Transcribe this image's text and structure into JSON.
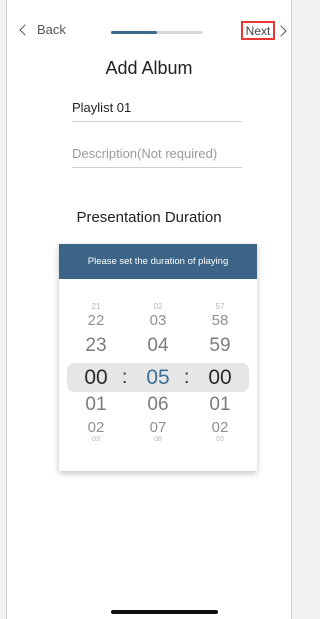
{
  "header": {
    "back_label": "Back",
    "next_label": "Next",
    "progress_fraction": 0.5
  },
  "title": "Add Album",
  "form": {
    "name_value": "Playlist 01",
    "description_placeholder": "Description(Not required)"
  },
  "duration": {
    "section_title": "Presentation Duration",
    "card_header": "Please set the duration of playing",
    "hours": [
      "21",
      "22",
      "23",
      "00",
      "01",
      "02",
      "03"
    ],
    "minutes": [
      "02",
      "03",
      "04",
      "05",
      "06",
      "07",
      "08"
    ],
    "seconds": [
      "57",
      "58",
      "59",
      "00",
      "01",
      "02",
      "03"
    ],
    "separator": ":"
  },
  "colors": {
    "accent": "#3b6486",
    "highlight_border": "#e53935",
    "selected_minute": "#3d6f97"
  }
}
